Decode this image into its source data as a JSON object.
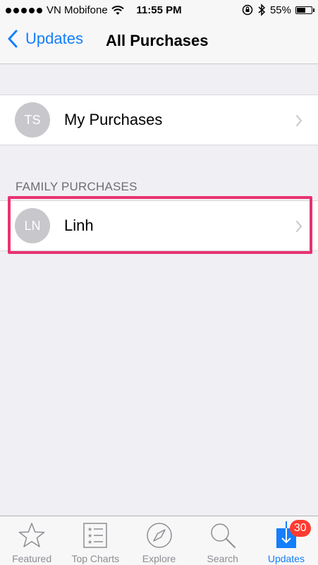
{
  "status_bar": {
    "carrier": "VN Mobifone",
    "time": "11:55 PM",
    "battery": "55%"
  },
  "nav": {
    "back_label": "Updates",
    "title": "All Purchases"
  },
  "my_purchases": {
    "initials": "TS",
    "label": "My Purchases"
  },
  "family": {
    "header": "FAMILY PURCHASES",
    "members": [
      {
        "initials": "LN",
        "label": "Linh"
      }
    ]
  },
  "tabs": [
    {
      "label": "Featured",
      "icon": "star-icon"
    },
    {
      "label": "Top Charts",
      "icon": "list-icon"
    },
    {
      "label": "Explore",
      "icon": "compass-icon"
    },
    {
      "label": "Search",
      "icon": "search-icon"
    },
    {
      "label": "Updates",
      "icon": "download-icon",
      "badge": "30",
      "active": true
    }
  ],
  "colors": {
    "accent": "#147efb",
    "highlight": "#e8336f",
    "badge": "#ff3b30"
  }
}
